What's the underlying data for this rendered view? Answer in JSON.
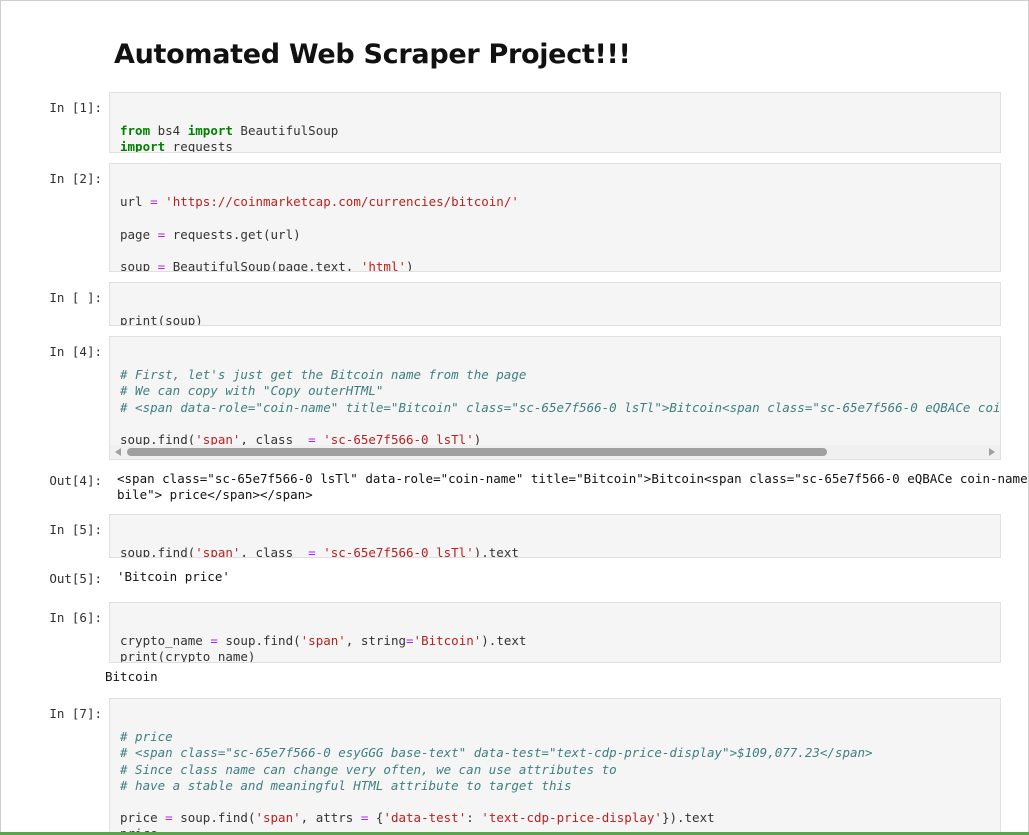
{
  "notebook": {
    "title": "Automated Web Scraper Project!!!",
    "cells": [
      {
        "prompt": "In [1]:"
      },
      {
        "prompt": "In [2]:"
      },
      {
        "prompt": "In [ ]:"
      },
      {
        "prompt": "In [4]:",
        "out_prompt": "Out[4]:",
        "output_lines": [
          "<span class=\"sc-65e7f566-0 lsTl\" data-role=\"coin-name\" title=\"Bitcoin\">Bitcoin<span class=\"sc-65e7f566-0 eQBACe coin-name-mo",
          "bile\"> price</span></span>"
        ]
      },
      {
        "prompt": "In [5]:",
        "out_prompt": "Out[5]:",
        "output_lines": [
          "'Bitcoin price'"
        ]
      },
      {
        "prompt": "In [6]:",
        "stdout": "Bitcoin"
      },
      {
        "prompt": "In [7]:"
      }
    ],
    "code": {
      "c1_l1_kw": "from",
      "c1_l1_a": " bs4 ",
      "c1_l1_kw2": "import",
      "c1_l1_b": " BeautifulSoup",
      "c1_l2_kw": "import",
      "c1_l2_a": " requests",
      "c2_l1_a": "url ",
      "c2_l1_op": "=",
      "c2_l1_sp": " ",
      "c2_l1_str": "'https://coinmarketcap.com/currencies/bitcoin/'",
      "c2_l3_a": "page ",
      "c2_l3_op": "=",
      "c2_l3_b": " requests.get(url)",
      "c2_l5_a": "soup ",
      "c2_l5_op": "=",
      "c2_l5_b": " BeautifulSoup(page.text, ",
      "c2_l5_str": "'html'",
      "c2_l5_c": ")",
      "c3_l1": "print(soup)",
      "c4_l1": "# First, let's just get the Bitcoin name from the page",
      "c4_l2": "# We can copy with \"Copy outerHTML\"",
      "c4_l3": "# <span data-role=\"coin-name\" title=\"Bitcoin\" class=\"sc-65e7f566-0 lsTl\">Bitcoin<span class=\"sc-65e7f566-0 eQBACe coin-name-",
      "c4_l5_a": "soup.find(",
      "c4_l5_s1": "'span'",
      "c4_l5_b": ", class_ ",
      "c4_l5_op": "=",
      "c4_l5_sp": " ",
      "c4_l5_s2": "'sc-65e7f566-0 lsTl'",
      "c4_l5_c": ")",
      "c5_l1_a": "soup.find(",
      "c5_l1_s1": "'span'",
      "c5_l1_b": ", class_ ",
      "c5_l1_op": "=",
      "c5_l1_sp": " ",
      "c5_l1_s2": "'sc-65e7f566-0 lsTl'",
      "c5_l1_c": ").text",
      "c6_l1_a": "crypto_name ",
      "c6_l1_op": "=",
      "c6_l1_b": " soup.find(",
      "c6_l1_s1": "'span'",
      "c6_l1_c": ", string",
      "c6_l1_op2": "=",
      "c6_l1_s2": "'Bitcoin'",
      "c6_l1_d": ").text",
      "c6_l2": "print(crypto_name)",
      "c7_l1": "# price",
      "c7_l2": "# <span class=\"sc-65e7f566-0 esyGGG base-text\" data-test=\"text-cdp-price-display\">$109,077.23</span>",
      "c7_l3": "# Since class name can change very often, we can use attributes to",
      "c7_l4": "# have a stable and meaningful HTML attribute to target this",
      "c7_l6_a": "price ",
      "c7_l6_op": "=",
      "c7_l6_b": " soup.find(",
      "c7_l6_s1": "'span'",
      "c7_l6_c": ", attrs ",
      "c7_l6_op2": "=",
      "c7_l6_d": " {",
      "c7_l6_s2": "'data-test'",
      "c7_l6_e": ": ",
      "c7_l6_s3": "'text-cdp-price-display'",
      "c7_l6_f": "}).text",
      "c7_l7": "price"
    }
  }
}
